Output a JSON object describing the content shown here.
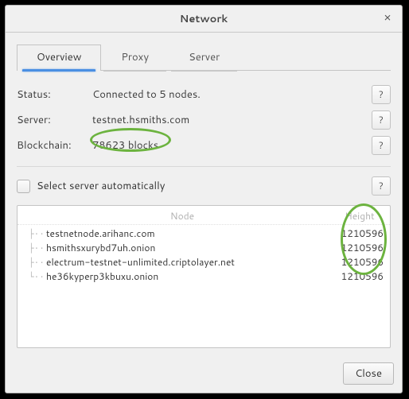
{
  "window": {
    "title": "Network"
  },
  "tabs": {
    "overview": "Overview",
    "proxy": "Proxy",
    "server": "Server",
    "active": "overview"
  },
  "status": {
    "label": "Status:",
    "value": "Connected to 5 nodes."
  },
  "server": {
    "label": "Server:",
    "value": "testnet.hsmiths.com"
  },
  "blockchain": {
    "label": "Blockchain:",
    "value": "78623 blocks"
  },
  "auto_select": {
    "label": "Select server automatically",
    "checked": false
  },
  "columns": {
    "node": "Node",
    "height": "Height"
  },
  "nodes": [
    {
      "host": "testnetnode.arihanc.com",
      "height": "1210596"
    },
    {
      "host": "hsmithsxurybd7uh.onion",
      "height": "1210596"
    },
    {
      "host": "electrum-testnet-unlimited.criptolayer.net",
      "height": "1210596"
    },
    {
      "host": "he36kyperp3kbuxu.onion",
      "height": "1210596"
    }
  ],
  "help_tooltip": "?",
  "buttons": {
    "close": "Close"
  }
}
